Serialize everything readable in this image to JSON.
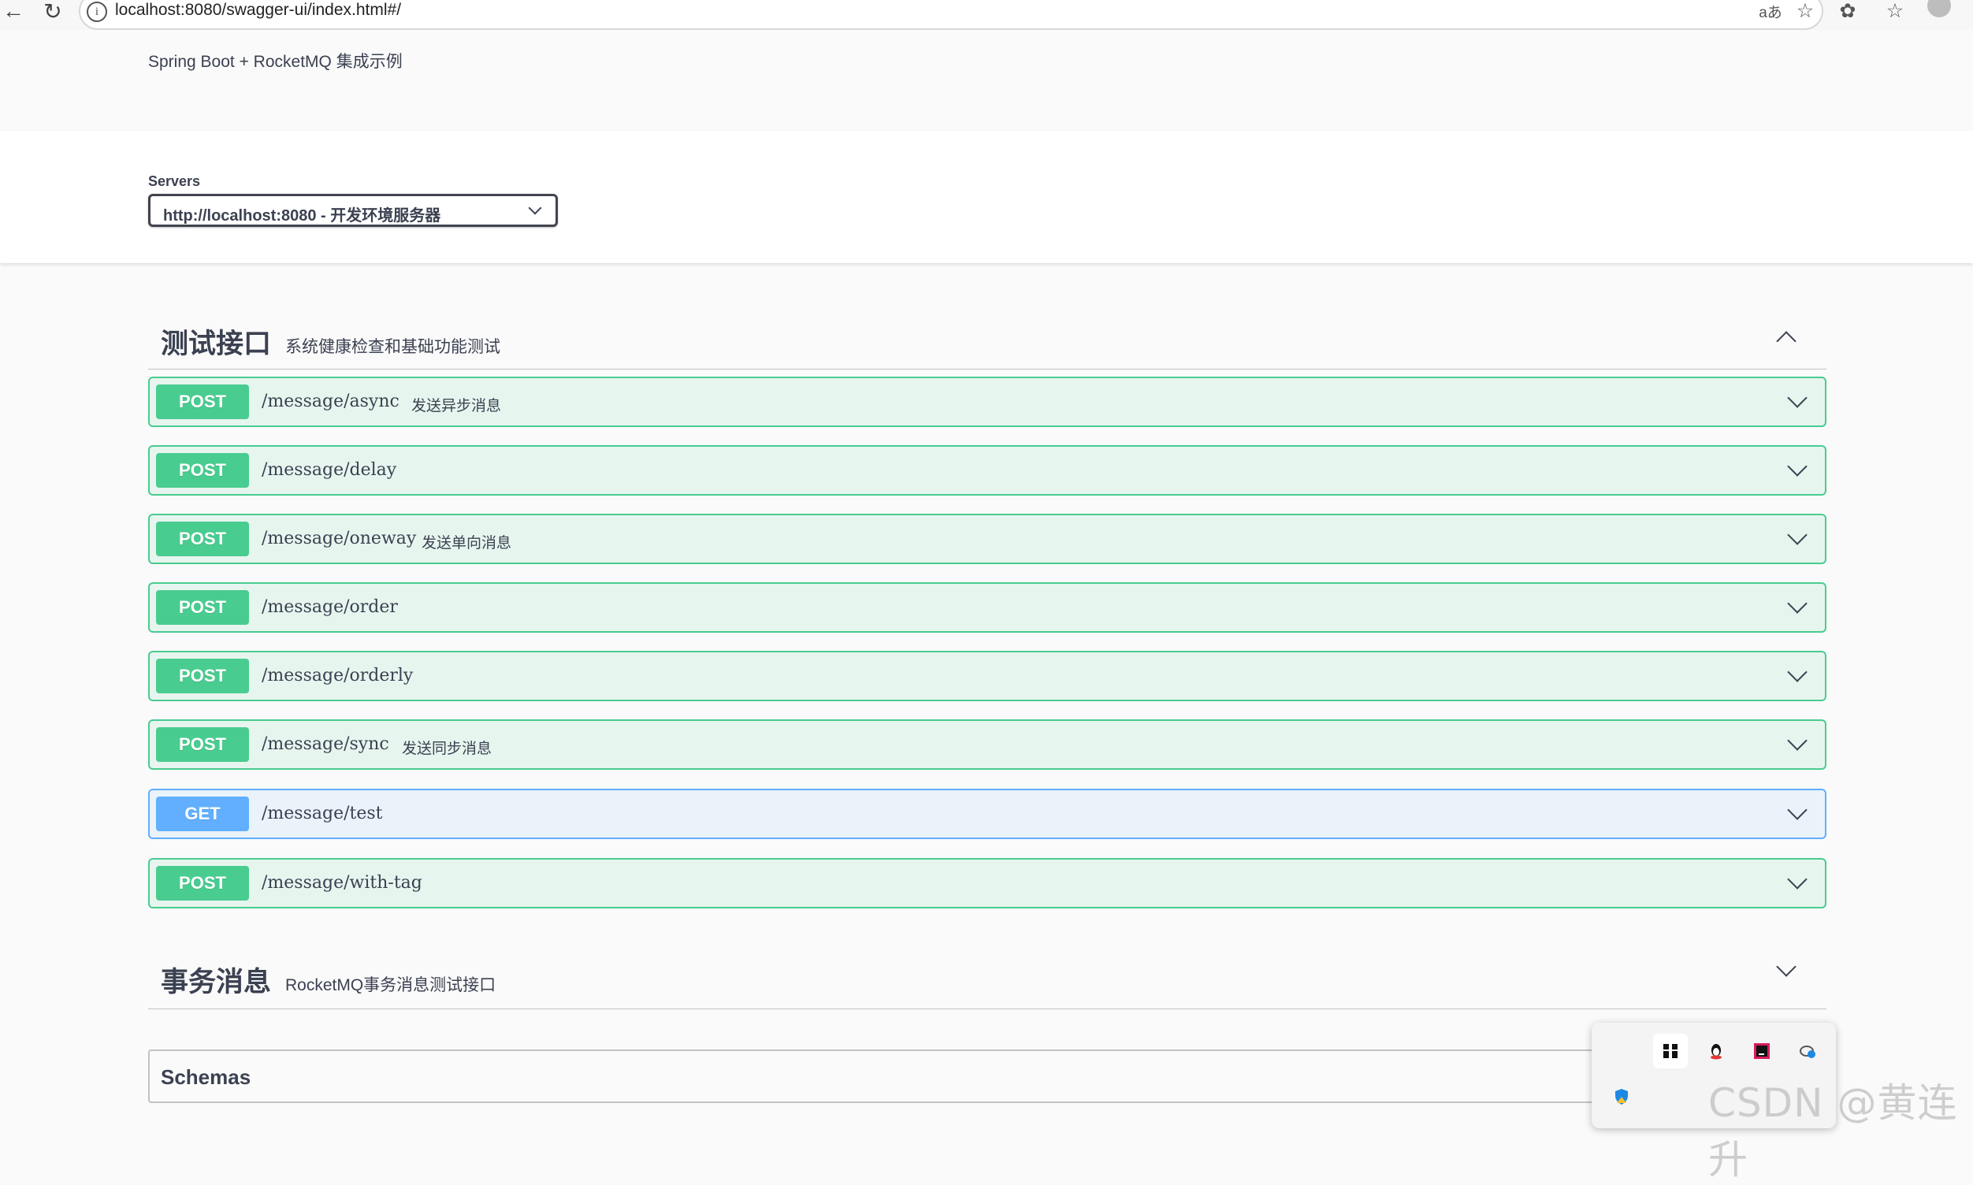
{
  "browser": {
    "url": "localhost:8080/swagger-ui/index.html#/"
  },
  "info": {
    "description": "Spring Boot + RocketMQ 集成示例"
  },
  "servers": {
    "label": "Servers",
    "selected": "http://localhost:8080 - 开发环境服务器"
  },
  "tags": [
    {
      "name": "测试接口",
      "description": "系统健康检查和基础功能测试",
      "expanded": true,
      "operations": [
        {
          "method": "POST",
          "path": "/message/async",
          "summary": "发送异步消息"
        },
        {
          "method": "POST",
          "path": "/message/delay",
          "summary": ""
        },
        {
          "method": "POST",
          "path": "/message/oneway",
          "summary": "发送单向消息"
        },
        {
          "method": "POST",
          "path": "/message/order",
          "summary": ""
        },
        {
          "method": "POST",
          "path": "/message/orderly",
          "summary": ""
        },
        {
          "method": "POST",
          "path": "/message/sync",
          "summary": "发送同步消息"
        },
        {
          "method": "GET",
          "path": "/message/test",
          "summary": ""
        },
        {
          "method": "POST",
          "path": "/message/with-tag",
          "summary": ""
        }
      ]
    },
    {
      "name": "事务消息",
      "description": "RocketMQ事务消息测试接口",
      "expanded": false
    }
  ],
  "schemas": {
    "title": "Schemas"
  },
  "watermark": "CSDN @黄连升",
  "colors": {
    "post": "#49cc90",
    "get": "#61affe",
    "text": "#3b4151"
  }
}
